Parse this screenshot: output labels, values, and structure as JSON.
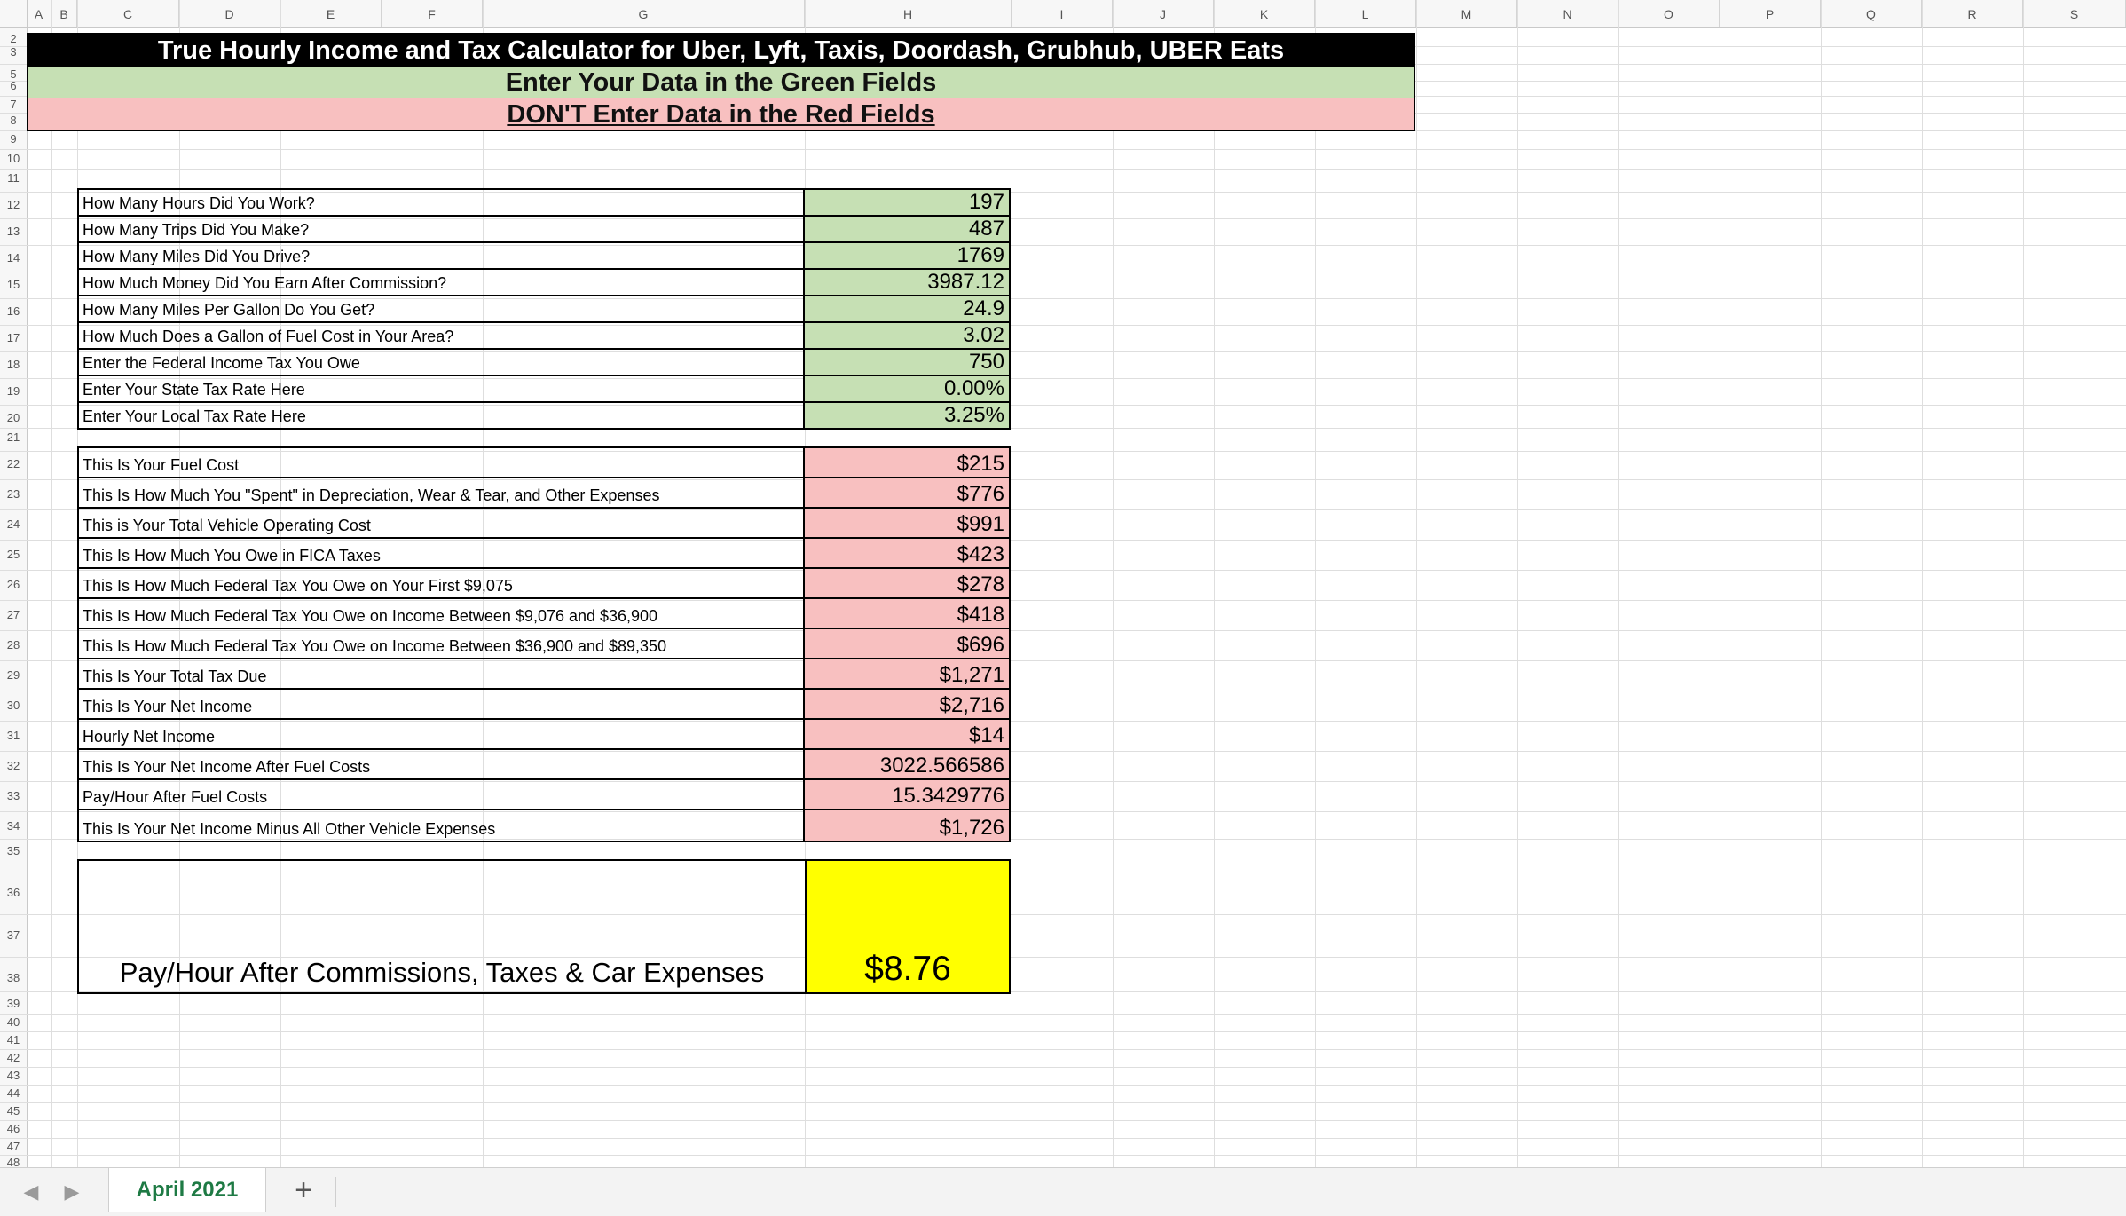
{
  "columns": [
    "A",
    "B",
    "C",
    "D",
    "E",
    "F",
    "G",
    "H",
    "I",
    "J",
    "K",
    "L",
    "M",
    "N",
    "O",
    "P",
    "Q",
    "R",
    "S"
  ],
  "rows": [
    "2",
    "3",
    "5",
    "6",
    "7",
    "8",
    "9",
    "10",
    "11",
    "12",
    "13",
    "14",
    "15",
    "16",
    "17",
    "18",
    "19",
    "20",
    "21",
    "22",
    "23",
    "24",
    "25",
    "26",
    "27",
    "28",
    "29",
    "30",
    "31",
    "32",
    "33",
    "34",
    "35",
    "36",
    "37",
    "38",
    "39",
    "40",
    "41",
    "42",
    "43",
    "44",
    "45",
    "46",
    "47",
    "48"
  ],
  "header": {
    "title": "True Hourly Income and Tax Calculator for Uber, Lyft, Taxis, Doordash, Grubhub, UBER Eats",
    "green_instruction": "Enter Your Data in the Green Fields",
    "red_instruction": "DON'T Enter Data in the Red Fields"
  },
  "inputs": [
    {
      "label": "How Many Hours Did You Work?",
      "value": "197"
    },
    {
      "label": "How Many Trips Did You Make?",
      "value": "487"
    },
    {
      "label": "How Many Miles Did You Drive?",
      "value": "1769"
    },
    {
      "label": "How Much Money Did You Earn After Commission?",
      "value": "3987.12"
    },
    {
      "label": "How Many Miles Per Gallon Do You Get?",
      "value": "24.9"
    },
    {
      "label": "How Much Does a Gallon of Fuel Cost in Your Area?",
      "value": "3.02"
    },
    {
      "label": "Enter the Federal Income Tax You Owe",
      "value": "750"
    },
    {
      "label": "Enter Your State Tax Rate Here",
      "value": "0.00%"
    },
    {
      "label": "Enter Your Local Tax Rate Here",
      "value": "3.25%"
    }
  ],
  "outputs": [
    {
      "label": "This Is Your Fuel Cost",
      "value": "$215"
    },
    {
      "label": "This Is How Much You \"Spent\" in Depreciation, Wear & Tear, and Other Expenses",
      "value": "$776"
    },
    {
      "label": "This is Your Total Vehicle Operating Cost",
      "value": "$991"
    },
    {
      "label": "This Is How Much You Owe in FICA Taxes",
      "value": "$423"
    },
    {
      "label": "This Is How Much Federal Tax You Owe on Your First $9,075",
      "value": "$278"
    },
    {
      "label": "This Is How Much Federal Tax You Owe on Income Between $9,076 and $36,900",
      "value": "$418"
    },
    {
      "label": "This Is How Much Federal Tax You Owe on Income Between $36,900 and $89,350",
      "value": "$696"
    },
    {
      "label": "This Is Your Total Tax Due",
      "value": "$1,271"
    },
    {
      "label": "This Is Your Net Income",
      "value": "$2,716"
    },
    {
      "label": "Hourly Net Income",
      "value": "$14"
    },
    {
      "label": "This Is Your Net Income After Fuel Costs",
      "value": "3022.566586"
    },
    {
      "label": "Pay/Hour After Fuel Costs",
      "value": "15.3429776"
    },
    {
      "label": "This Is Your Net Income Minus All Other Vehicle Expenses",
      "value": "$1,726"
    }
  ],
  "summary": {
    "label": "Pay/Hour After Commissions, Taxes & Car Expenses",
    "value": "$8.76"
  },
  "tabbar": {
    "sheet_name": "April 2021",
    "add_symbol": "+",
    "prev_symbol": "◀",
    "next_symbol": "▶"
  }
}
